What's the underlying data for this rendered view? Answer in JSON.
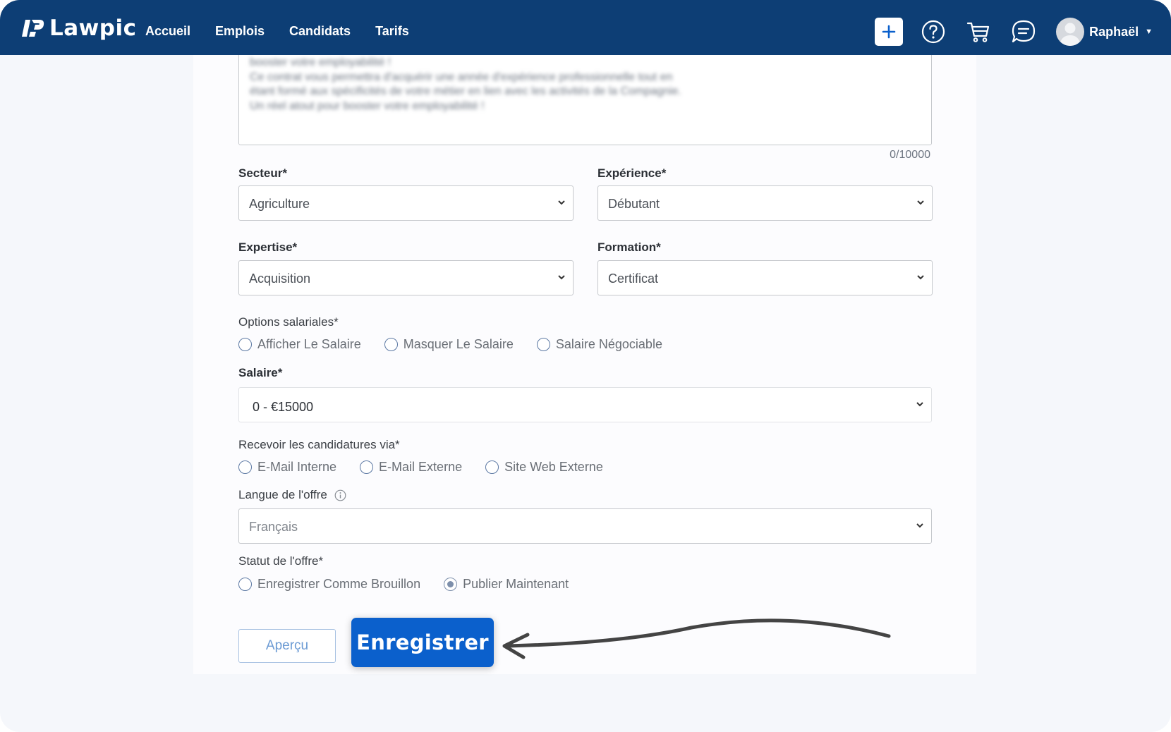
{
  "navbar": {
    "brand": "Lawpic",
    "links": [
      "Accueil",
      "Emplois",
      "Candidats",
      "Tarifs"
    ],
    "user_name": "Raphaël",
    "icons": [
      "plus-icon",
      "help-icon",
      "cart-icon",
      "chat-icon",
      "avatar",
      "caret-down-icon"
    ]
  },
  "description": {
    "blurred_lines": [
      "booster votre employabilité !",
      "Ce contrat vous permettra d'acquérir une année d'expérience professionnelle tout en",
      "étant formé aux spécificités de votre métier en lien avec les activités de la Compagnie.",
      "Un réel atout pour booster votre employabilité !"
    ],
    "counter": "0/10000"
  },
  "fields": {
    "secteur": {
      "label": "Secteur*",
      "value": "Agriculture"
    },
    "experience": {
      "label": "Expérience*",
      "value": "Débutant"
    },
    "expertise": {
      "label": "Expertise*",
      "value": "Acquisition"
    },
    "formation": {
      "label": "Formation*",
      "value": "Certificat"
    },
    "salary_options": {
      "label": "Options salariales*",
      "options": [
        "Afficher Le Salaire",
        "Masquer Le Salaire",
        "Salaire Négociable"
      ]
    },
    "salaire": {
      "label": "Salaire*",
      "value": "0 - €15000"
    },
    "receive_via": {
      "label": "Recevoir les candidatures via*",
      "options": [
        "E-Mail Interne",
        "E-Mail Externe",
        "Site Web Externe"
      ]
    },
    "langue": {
      "label": "Langue de l'offre",
      "value": "Français"
    },
    "statut": {
      "label": "Statut de l'offre*",
      "options": [
        "Enregistrer Comme Brouillon",
        "Publier Maintenant"
      ],
      "selected": "Publier Maintenant"
    }
  },
  "buttons": {
    "preview": "Aperçu",
    "save": "Enregistrer"
  },
  "colors": {
    "navbar": "#0d3e75",
    "save_button": "#0b60cc",
    "radio_border": "#5b78a3"
  }
}
